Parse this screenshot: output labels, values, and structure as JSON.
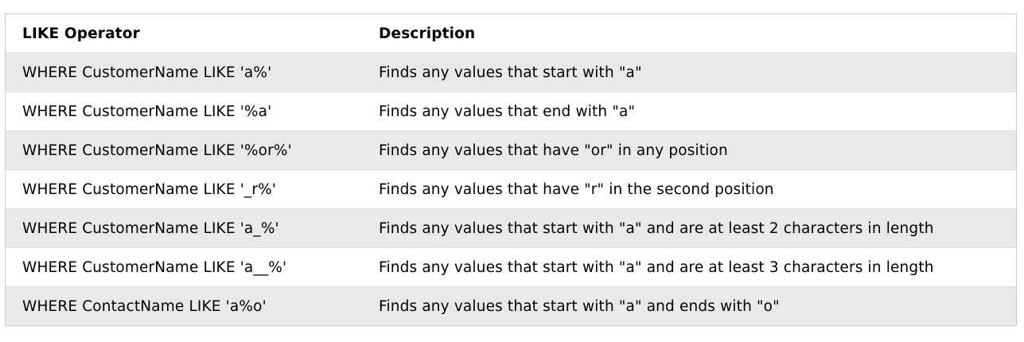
{
  "table": {
    "headers": {
      "operator": "LIKE Operator",
      "description": "Description"
    },
    "rows": [
      {
        "operator": "WHERE CustomerName LIKE 'a%'",
        "description": "Finds any values that start with \"a\""
      },
      {
        "operator": "WHERE CustomerName LIKE '%a'",
        "description": "Finds any values that end with \"a\""
      },
      {
        "operator": "WHERE CustomerName LIKE '%or%'",
        "description": "Finds any values that have \"or\" in any position"
      },
      {
        "operator": "WHERE CustomerName LIKE '_r%'",
        "description": "Finds any values that have \"r\" in the second position"
      },
      {
        "operator": "WHERE CustomerName LIKE 'a_%'",
        "description": "Finds any values that start with \"a\" and are at least 2 characters in length"
      },
      {
        "operator": "WHERE CustomerName LIKE 'a__%'",
        "description": "Finds any values that start with \"a\" and are at least 3 characters in length"
      },
      {
        "operator": "WHERE ContactName LIKE 'a%o'",
        "description": "Finds any values that start with \"a\" and ends with \"o\""
      }
    ]
  },
  "colors": {
    "stripe": "#e7e9eb",
    "border": "#cccccc",
    "text": "#000000"
  }
}
